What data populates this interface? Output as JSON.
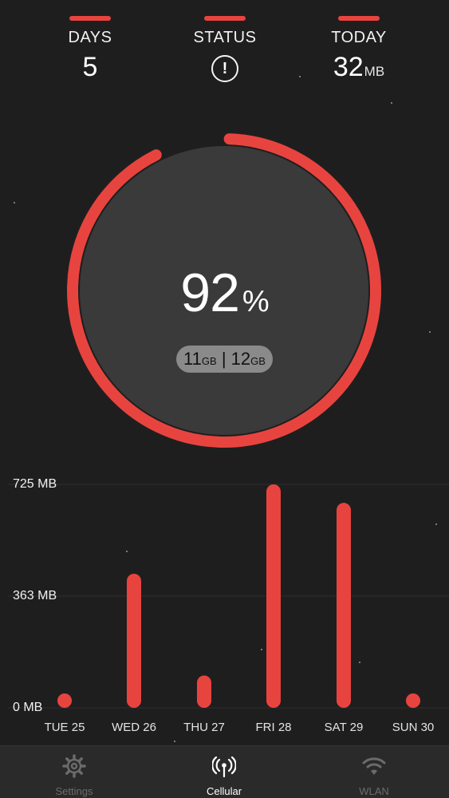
{
  "header": {
    "days": {
      "label": "DAYS",
      "value": "5"
    },
    "status": {
      "label": "STATUS",
      "icon": "alert-circle-icon",
      "glyph": "!"
    },
    "today": {
      "label": "TODAY",
      "value": "32",
      "unit": "MB"
    }
  },
  "usage": {
    "percent": "92",
    "percent_symbol": "%",
    "fraction": 0.92,
    "used": "11",
    "used_unit": "GB",
    "separator": "|",
    "total": "12",
    "total_unit": "GB"
  },
  "colors": {
    "accent": "#e8443f",
    "background": "#1f1e1f",
    "ring_fill": "#3a3a3a"
  },
  "chart_data": {
    "type": "bar",
    "categories": [
      "TUE 25",
      "WED 26",
      "THU 27",
      "FRI 28",
      "SAT 29",
      "SUN 30"
    ],
    "values": [
      30,
      435,
      105,
      725,
      665,
      25
    ],
    "yticks": [
      "725 MB",
      "363  MB",
      "0 MB"
    ],
    "ylim": [
      0,
      725
    ],
    "color": "#e8443f"
  },
  "tabbar": {
    "items": [
      {
        "label": "Settings",
        "icon": "gear-icon"
      },
      {
        "label": "Cellular",
        "icon": "antenna-icon"
      },
      {
        "label": "WLAN",
        "icon": "wifi-icon"
      }
    ]
  }
}
